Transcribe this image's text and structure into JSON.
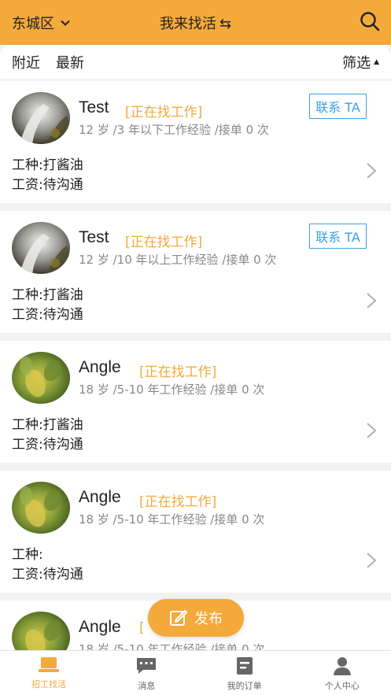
{
  "header": {
    "district": "东城区",
    "title": "我来找活",
    "title_icon": "swap-arrows-icon",
    "search_icon": "search-icon",
    "accent_color": "#f4a93b"
  },
  "filterbar": {
    "tabs": [
      "附近",
      "最新"
    ],
    "filter_label": "筛选"
  },
  "cards": [
    {
      "name": "Test",
      "status": "[正在找工作]",
      "meta": "12 岁 /3 年以下工作经验 /接单 0 次",
      "contact": "联系 TA",
      "line1": "工种:打酱油",
      "line2": "工资:待沟通",
      "avatar": "waterfall"
    },
    {
      "name": "Test",
      "status": "[正在找工作]",
      "meta": "12 岁 /10 年以上工作经验 /接单 0 次",
      "contact": "联系 TA",
      "line1": "工种:打酱油",
      "line2": "工资:待沟通",
      "avatar": "waterfall"
    },
    {
      "name": "Angle",
      "status": "[正在找工作]",
      "meta": "18 岁 /5-10 年工作经验 /接单 0 次",
      "contact": "",
      "line1": "工种:打酱油",
      "line2": "工资:待沟通",
      "avatar": "leaves"
    },
    {
      "name": "Angle",
      "status": "[正在找工作]",
      "meta": "18 岁 /5-10 年工作经验 /接单 0 次",
      "contact": "",
      "line1": "工种:",
      "line2": "工资:待沟通",
      "avatar": "leaves"
    },
    {
      "name": "Angle",
      "status": "[",
      "meta": "18 岁 /5-10 年工作经验 /接单 0 次",
      "contact": "",
      "line1": "",
      "line2": "",
      "avatar": "leaves"
    }
  ],
  "publish_button": {
    "label": "发布",
    "icon": "edit-icon"
  },
  "tabbar": [
    {
      "label": "招工找活",
      "icon": "laptop-icon",
      "active": true
    },
    {
      "label": "消息",
      "icon": "chat-icon",
      "active": false
    },
    {
      "label": "我的订单",
      "icon": "order-icon",
      "active": false
    },
    {
      "label": "个人中心",
      "icon": "person-icon",
      "active": false
    }
  ]
}
